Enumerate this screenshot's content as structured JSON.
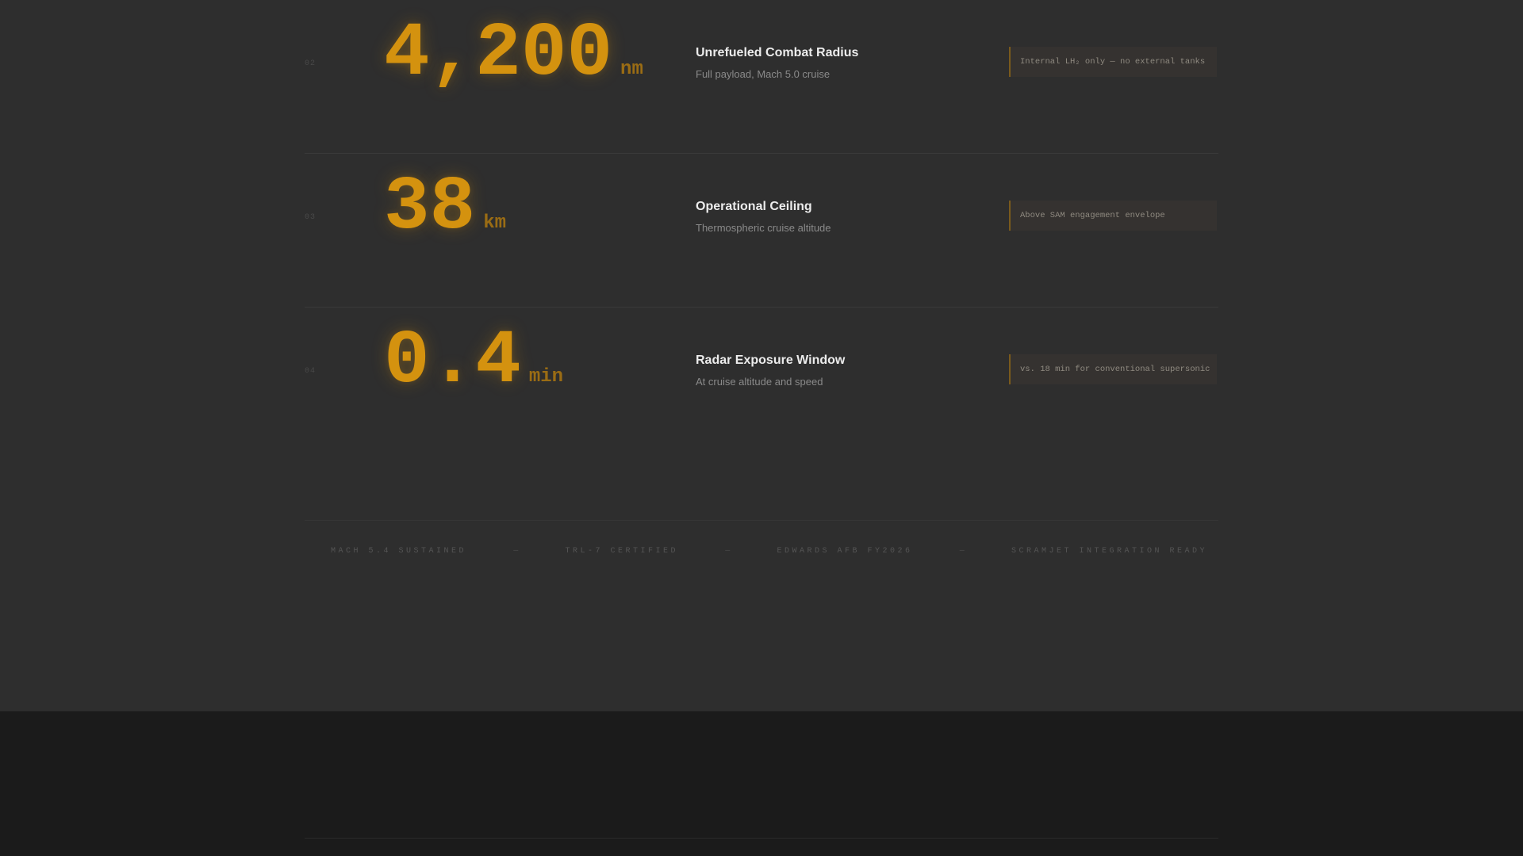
{
  "colors": {
    "accent": "#d4920f",
    "unit": "#9a6c14",
    "background_upper": "#2e2e2e",
    "background_lower": "#1b1b1b",
    "title_text": "#ececec",
    "sub_text": "#8a8a8a"
  },
  "metrics": [
    {
      "index": "02",
      "value": "4,200",
      "unit": "nm",
      "title": "Unrefueled Combat Radius",
      "subtitle": "Full payload, Mach 5.0 cruise",
      "note": "Internal LH₂ only — no external tanks"
    },
    {
      "index": "03",
      "value": "38",
      "unit": "km",
      "title": "Operational Ceiling",
      "subtitle": "Thermospheric cruise altitude",
      "note": "Above SAM engagement envelope"
    },
    {
      "index": "04",
      "value": "0.4",
      "unit": "min",
      "title": "Radar Exposure Window",
      "subtitle": "At cruise altitude and speed",
      "note": "vs. 18 min for conventional supersonic"
    }
  ],
  "footer": {
    "tags": [
      "MACH 5.4 SUSTAINED",
      "TRL-7 CERTIFIED",
      "EDWARDS AFB FY2026",
      "SCRAMJET INTEGRATION READY"
    ],
    "separator": "—"
  }
}
